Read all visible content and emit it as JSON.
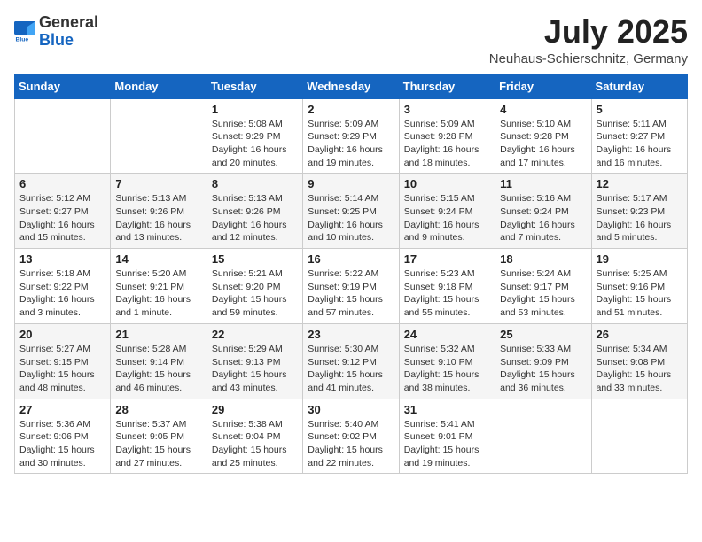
{
  "logo": {
    "general": "General",
    "blue": "Blue"
  },
  "title": "July 2025",
  "location": "Neuhaus-Schierschnitz, Germany",
  "days_of_week": [
    "Sunday",
    "Monday",
    "Tuesday",
    "Wednesday",
    "Thursday",
    "Friday",
    "Saturday"
  ],
  "weeks": [
    [
      {
        "day": "",
        "info": ""
      },
      {
        "day": "",
        "info": ""
      },
      {
        "day": "1",
        "info": "Sunrise: 5:08 AM\nSunset: 9:29 PM\nDaylight: 16 hours and 20 minutes."
      },
      {
        "day": "2",
        "info": "Sunrise: 5:09 AM\nSunset: 9:29 PM\nDaylight: 16 hours and 19 minutes."
      },
      {
        "day": "3",
        "info": "Sunrise: 5:09 AM\nSunset: 9:28 PM\nDaylight: 16 hours and 18 minutes."
      },
      {
        "day": "4",
        "info": "Sunrise: 5:10 AM\nSunset: 9:28 PM\nDaylight: 16 hours and 17 minutes."
      },
      {
        "day": "5",
        "info": "Sunrise: 5:11 AM\nSunset: 9:27 PM\nDaylight: 16 hours and 16 minutes."
      }
    ],
    [
      {
        "day": "6",
        "info": "Sunrise: 5:12 AM\nSunset: 9:27 PM\nDaylight: 16 hours and 15 minutes."
      },
      {
        "day": "7",
        "info": "Sunrise: 5:13 AM\nSunset: 9:26 PM\nDaylight: 16 hours and 13 minutes."
      },
      {
        "day": "8",
        "info": "Sunrise: 5:13 AM\nSunset: 9:26 PM\nDaylight: 16 hours and 12 minutes."
      },
      {
        "day": "9",
        "info": "Sunrise: 5:14 AM\nSunset: 9:25 PM\nDaylight: 16 hours and 10 minutes."
      },
      {
        "day": "10",
        "info": "Sunrise: 5:15 AM\nSunset: 9:24 PM\nDaylight: 16 hours and 9 minutes."
      },
      {
        "day": "11",
        "info": "Sunrise: 5:16 AM\nSunset: 9:24 PM\nDaylight: 16 hours and 7 minutes."
      },
      {
        "day": "12",
        "info": "Sunrise: 5:17 AM\nSunset: 9:23 PM\nDaylight: 16 hours and 5 minutes."
      }
    ],
    [
      {
        "day": "13",
        "info": "Sunrise: 5:18 AM\nSunset: 9:22 PM\nDaylight: 16 hours and 3 minutes."
      },
      {
        "day": "14",
        "info": "Sunrise: 5:20 AM\nSunset: 9:21 PM\nDaylight: 16 hours and 1 minute."
      },
      {
        "day": "15",
        "info": "Sunrise: 5:21 AM\nSunset: 9:20 PM\nDaylight: 15 hours and 59 minutes."
      },
      {
        "day": "16",
        "info": "Sunrise: 5:22 AM\nSunset: 9:19 PM\nDaylight: 15 hours and 57 minutes."
      },
      {
        "day": "17",
        "info": "Sunrise: 5:23 AM\nSunset: 9:18 PM\nDaylight: 15 hours and 55 minutes."
      },
      {
        "day": "18",
        "info": "Sunrise: 5:24 AM\nSunset: 9:17 PM\nDaylight: 15 hours and 53 minutes."
      },
      {
        "day": "19",
        "info": "Sunrise: 5:25 AM\nSunset: 9:16 PM\nDaylight: 15 hours and 51 minutes."
      }
    ],
    [
      {
        "day": "20",
        "info": "Sunrise: 5:27 AM\nSunset: 9:15 PM\nDaylight: 15 hours and 48 minutes."
      },
      {
        "day": "21",
        "info": "Sunrise: 5:28 AM\nSunset: 9:14 PM\nDaylight: 15 hours and 46 minutes."
      },
      {
        "day": "22",
        "info": "Sunrise: 5:29 AM\nSunset: 9:13 PM\nDaylight: 15 hours and 43 minutes."
      },
      {
        "day": "23",
        "info": "Sunrise: 5:30 AM\nSunset: 9:12 PM\nDaylight: 15 hours and 41 minutes."
      },
      {
        "day": "24",
        "info": "Sunrise: 5:32 AM\nSunset: 9:10 PM\nDaylight: 15 hours and 38 minutes."
      },
      {
        "day": "25",
        "info": "Sunrise: 5:33 AM\nSunset: 9:09 PM\nDaylight: 15 hours and 36 minutes."
      },
      {
        "day": "26",
        "info": "Sunrise: 5:34 AM\nSunset: 9:08 PM\nDaylight: 15 hours and 33 minutes."
      }
    ],
    [
      {
        "day": "27",
        "info": "Sunrise: 5:36 AM\nSunset: 9:06 PM\nDaylight: 15 hours and 30 minutes."
      },
      {
        "day": "28",
        "info": "Sunrise: 5:37 AM\nSunset: 9:05 PM\nDaylight: 15 hours and 27 minutes."
      },
      {
        "day": "29",
        "info": "Sunrise: 5:38 AM\nSunset: 9:04 PM\nDaylight: 15 hours and 25 minutes."
      },
      {
        "day": "30",
        "info": "Sunrise: 5:40 AM\nSunset: 9:02 PM\nDaylight: 15 hours and 22 minutes."
      },
      {
        "day": "31",
        "info": "Sunrise: 5:41 AM\nSunset: 9:01 PM\nDaylight: 15 hours and 19 minutes."
      },
      {
        "day": "",
        "info": ""
      },
      {
        "day": "",
        "info": ""
      }
    ]
  ]
}
